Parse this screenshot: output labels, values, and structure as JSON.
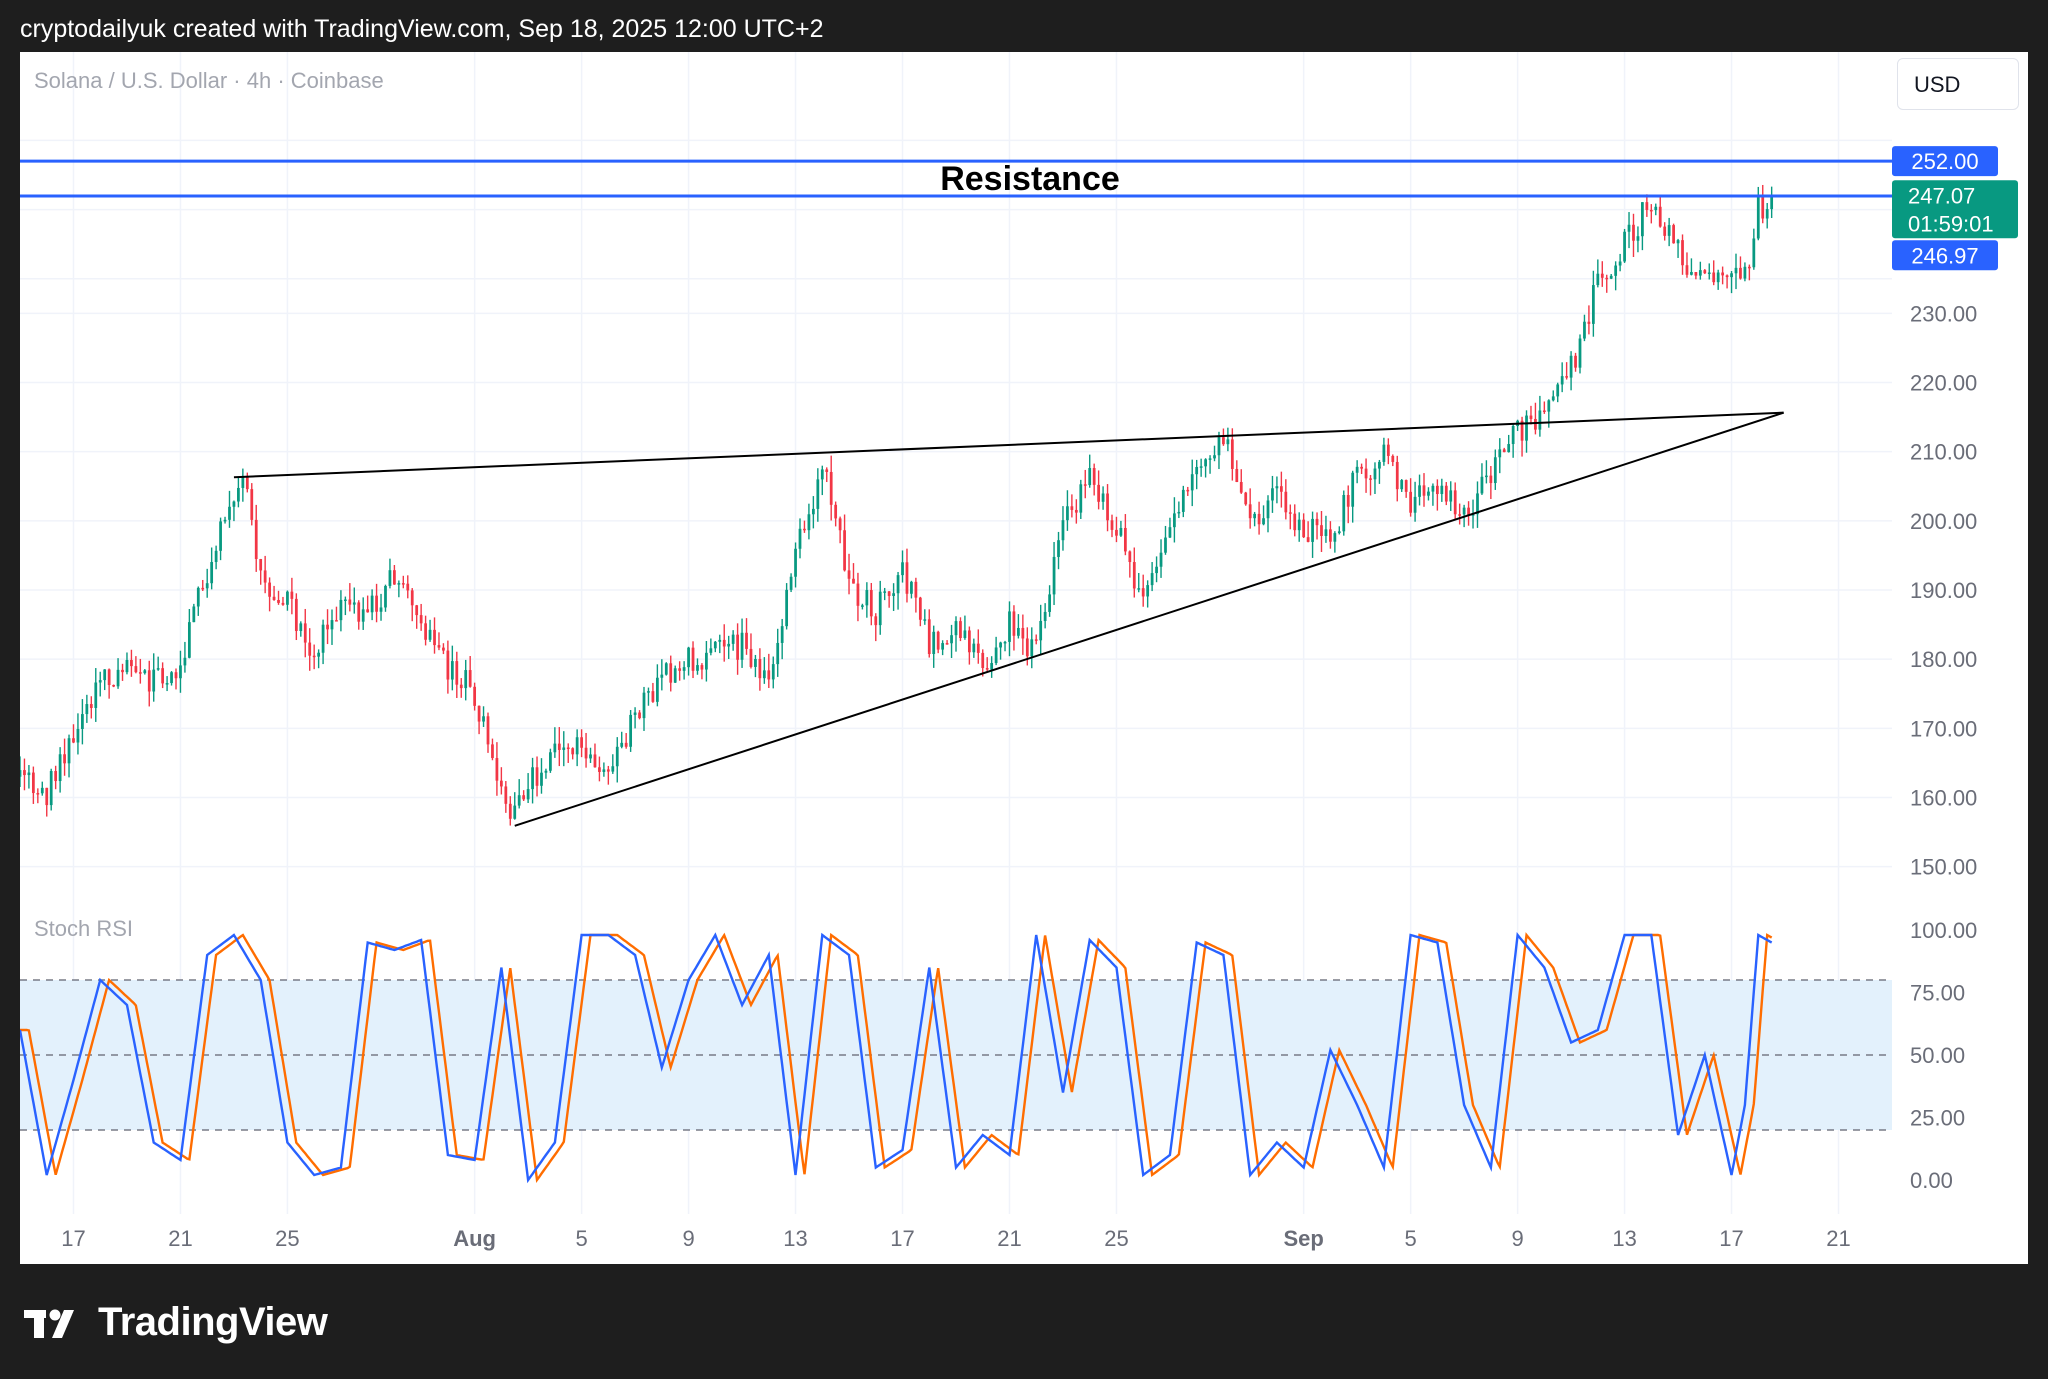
{
  "header": {
    "title": "cryptodailyuk created with TradingView.com, Sep 18, 2025 12:00 UTC+2"
  },
  "chart": {
    "symbol": "Solana / U.S. Dollar · 4h · Coinbase",
    "currency": "USD"
  },
  "footer": {
    "brand": "TradingView"
  },
  "colors": {
    "up": "#089981",
    "down": "#f23645",
    "resistance": "#2962ff",
    "stoch_k": "#2962ff",
    "stoch_d": "#ff6d00",
    "stoch_band": "#e3f1fc"
  },
  "chart_data": [
    {
      "type": "candlestick",
      "title": "Solana / U.S. Dollar · 4h · Coinbase",
      "timeframe": "4h",
      "x_axis": {
        "ticks": [
          {
            "label": "17",
            "date": "2025-07-17",
            "major": false
          },
          {
            "label": "21",
            "date": "2025-07-21",
            "major": false
          },
          {
            "label": "25",
            "date": "2025-07-25",
            "major": false
          },
          {
            "label": "Aug",
            "date": "2025-08-01",
            "major": true
          },
          {
            "label": "5",
            "date": "2025-08-05",
            "major": false
          },
          {
            "label": "9",
            "date": "2025-08-09",
            "major": false
          },
          {
            "label": "13",
            "date": "2025-08-13",
            "major": false
          },
          {
            "label": "17",
            "date": "2025-08-17",
            "major": false
          },
          {
            "label": "21",
            "date": "2025-08-21",
            "major": false
          },
          {
            "label": "25",
            "date": "2025-08-25",
            "major": false
          },
          {
            "label": "Sep",
            "date": "2025-09-01",
            "major": true
          },
          {
            "label": "5",
            "date": "2025-09-05",
            "major": false
          },
          {
            "label": "9",
            "date": "2025-09-09",
            "major": false
          },
          {
            "label": "13",
            "date": "2025-09-13",
            "major": false
          },
          {
            "label": "17",
            "date": "2025-09-17",
            "major": false
          },
          {
            "label": "21",
            "date": "2025-09-21",
            "major": false
          }
        ],
        "range": [
          "2025-07-15",
          "2025-09-23"
        ]
      },
      "y_axis": {
        "ticks": [
          "150.00",
          "160.00",
          "170.00",
          "180.00",
          "190.00",
          "200.00",
          "210.00",
          "220.00",
          "230.00"
        ],
        "range": [
          142,
          262
        ]
      },
      "price_labels": [
        {
          "value": "252.00",
          "kind": "line"
        },
        {
          "value": "247.07",
          "kind": "last",
          "countdown": "01:59:01"
        },
        {
          "value": "246.97",
          "kind": "line"
        }
      ],
      "close_path": [
        [
          "2025-07-15",
          163
        ],
        [
          "2025-07-16",
          161
        ],
        [
          "2025-07-17",
          170
        ],
        [
          "2025-07-18",
          177
        ],
        [
          "2025-07-19",
          178
        ],
        [
          "2025-07-20",
          177
        ],
        [
          "2025-07-21",
          179
        ],
        [
          "2025-07-22",
          193
        ],
        [
          "2025-07-22T12",
          200
        ],
        [
          "2025-07-23",
          204
        ],
        [
          "2025-07-23T08",
          206
        ],
        [
          "2025-07-24",
          192
        ],
        [
          "2025-07-25",
          188
        ],
        [
          "2025-07-26",
          181
        ],
        [
          "2025-07-27",
          188
        ],
        [
          "2025-07-28",
          187
        ],
        [
          "2025-07-29",
          192
        ],
        [
          "2025-07-30",
          186
        ],
        [
          "2025-07-31",
          179
        ],
        [
          "2025-08-01",
          175
        ],
        [
          "2025-08-02",
          162
        ],
        [
          "2025-08-02T12",
          157
        ],
        [
          "2025-08-03",
          162
        ],
        [
          "2025-08-04",
          166
        ],
        [
          "2025-08-05",
          167
        ],
        [
          "2025-08-06",
          164
        ],
        [
          "2025-08-07",
          172
        ],
        [
          "2025-08-08",
          177
        ],
        [
          "2025-08-09",
          180
        ],
        [
          "2025-08-10",
          181
        ],
        [
          "2025-08-11",
          182
        ],
        [
          "2025-08-12",
          177
        ],
        [
          "2025-08-13",
          195
        ],
        [
          "2025-08-14",
          207
        ],
        [
          "2025-08-14T08",
          204
        ],
        [
          "2025-08-15",
          190
        ],
        [
          "2025-08-16",
          187
        ],
        [
          "2025-08-17",
          193
        ],
        [
          "2025-08-18",
          182
        ],
        [
          "2025-08-19",
          184
        ],
        [
          "2025-08-20",
          179
        ],
        [
          "2025-08-21",
          185
        ],
        [
          "2025-08-22",
          181
        ],
        [
          "2025-08-23",
          200
        ],
        [
          "2025-08-24",
          206
        ],
        [
          "2025-08-25",
          199
        ],
        [
          "2025-08-26",
          188
        ],
        [
          "2025-08-27",
          200
        ],
        [
          "2025-08-28",
          207
        ],
        [
          "2025-08-29",
          212
        ],
        [
          "2025-08-30",
          200
        ],
        [
          "2025-08-31",
          204
        ],
        [
          "2025-09-01",
          199
        ],
        [
          "2025-09-02",
          197
        ],
        [
          "2025-09-03",
          207
        ],
        [
          "2025-09-04",
          209
        ],
        [
          "2025-09-05",
          203
        ],
        [
          "2025-09-06",
          204
        ],
        [
          "2025-09-07",
          201
        ],
        [
          "2025-09-08",
          206
        ],
        [
          "2025-09-09",
          213
        ],
        [
          "2025-09-10",
          216
        ],
        [
          "2025-09-11",
          222
        ],
        [
          "2025-09-12",
          234
        ],
        [
          "2025-09-13",
          240
        ],
        [
          "2025-09-14",
          246
        ],
        [
          "2025-09-15",
          239
        ],
        [
          "2025-09-16",
          234
        ],
        [
          "2025-09-17",
          236
        ],
        [
          "2025-09-17T12",
          235
        ],
        [
          "2025-09-18",
          245
        ],
        [
          "2025-09-18T12",
          247.07
        ]
      ],
      "resistance": {
        "label": "Resistance",
        "upper": 252.0,
        "lower": 246.97
      },
      "trendlines": [
        {
          "name": "wedge-upper",
          "from": [
            "2025-07-23",
            206.3
          ],
          "to": [
            "2025-09-18T12",
            215.5
          ]
        },
        {
          "name": "wedge-lower",
          "from": [
            "2025-08-02T12",
            155.9
          ],
          "to": [
            "2025-09-18T12",
            215.5
          ]
        }
      ]
    },
    {
      "type": "line",
      "title": "Stoch RSI",
      "y_axis": {
        "ticks": [
          "100.00",
          "75.00",
          "50.00",
          "25.00",
          "0.00"
        ],
        "range": [
          0,
          100
        ]
      },
      "band": {
        "upper": 80,
        "lower": 20
      },
      "series": [
        {
          "values_path": [
            [
              "2025-07-15",
              60
            ],
            [
              "2025-07-16",
              2
            ],
            [
              "2025-07-17",
              40
            ],
            [
              "2025-07-18",
              80
            ],
            [
              "2025-07-19",
              70
            ],
            [
              "2025-07-20",
              15
            ],
            [
              "2025-07-21",
              8
            ],
            [
              "2025-07-22",
              90
            ],
            [
              "2025-07-23",
              98
            ],
            [
              "2025-07-24",
              80
            ],
            [
              "2025-07-25",
              15
            ],
            [
              "2025-07-26",
              2
            ],
            [
              "2025-07-27",
              5
            ],
            [
              "2025-07-28",
              95
            ],
            [
              "2025-07-29",
              92
            ],
            [
              "2025-07-30",
              96
            ],
            [
              "2025-07-31",
              10
            ],
            [
              "2025-08-01",
              8
            ],
            [
              "2025-08-02",
              85
            ],
            [
              "2025-08-03",
              0
            ],
            [
              "2025-08-04",
              15
            ],
            [
              "2025-08-05",
              98
            ],
            [
              "2025-08-06",
              98
            ],
            [
              "2025-08-07",
              90
            ],
            [
              "2025-08-08",
              45
            ],
            [
              "2025-08-09",
              80
            ],
            [
              "2025-08-10",
              98
            ],
            [
              "2025-08-11",
              70
            ],
            [
              "2025-08-12",
              90
            ],
            [
              "2025-08-13",
              2
            ],
            [
              "2025-08-14",
              98
            ],
            [
              "2025-08-15",
              90
            ],
            [
              "2025-08-16",
              5
            ],
            [
              "2025-08-17",
              12
            ],
            [
              "2025-08-18",
              85
            ],
            [
              "2025-08-19",
              5
            ],
            [
              "2025-08-20",
              18
            ],
            [
              "2025-08-21",
              10
            ],
            [
              "2025-08-22",
              98
            ],
            [
              "2025-08-23",
              35
            ],
            [
              "2025-08-24",
              96
            ],
            [
              "2025-08-25",
              85
            ],
            [
              "2025-08-26",
              2
            ],
            [
              "2025-08-27",
              10
            ],
            [
              "2025-08-28",
              95
            ],
            [
              "2025-08-29",
              90
            ],
            [
              "2025-08-30",
              2
            ],
            [
              "2025-08-31",
              15
            ],
            [
              "2025-09-01",
              5
            ],
            [
              "2025-09-02",
              52
            ],
            [
              "2025-09-03",
              30
            ],
            [
              "2025-09-04",
              5
            ],
            [
              "2025-09-05",
              98
            ],
            [
              "2025-09-06",
              95
            ],
            [
              "2025-09-07",
              30
            ],
            [
              "2025-09-08",
              5
            ],
            [
              "2025-09-09",
              98
            ],
            [
              "2025-09-10",
              85
            ],
            [
              "2025-09-11",
              55
            ],
            [
              "2025-09-12",
              60
            ],
            [
              "2025-09-13",
              98
            ],
            [
              "2025-09-14",
              98
            ],
            [
              "2025-09-15",
              18
            ],
            [
              "2025-09-16",
              50
            ],
            [
              "2025-09-17",
              2
            ],
            [
              "2025-09-17T12",
              30
            ],
            [
              "2025-09-18",
              98
            ],
            [
              "2025-09-18T12",
              95
            ]
          ]
        },
        {
          "lag": "0.33d"
        }
      ],
      "x_axis": "shared"
    }
  ]
}
